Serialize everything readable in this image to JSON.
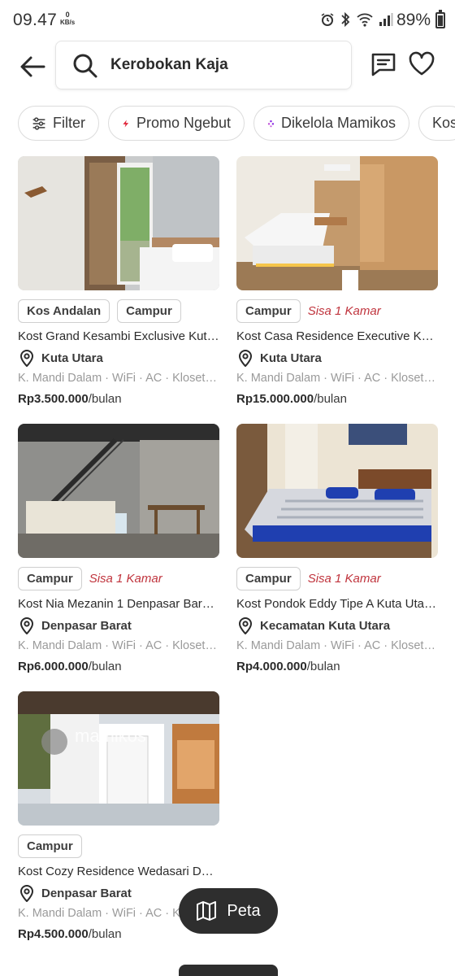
{
  "status_bar": {
    "time": "09.47",
    "net_speed": "0",
    "net_unit": "KB/s",
    "battery": "89%"
  },
  "header": {
    "search_value": "Kerobokan Kaja"
  },
  "chips": [
    {
      "label": "Filter",
      "icon": "sliders-icon"
    },
    {
      "label": "Promo Ngebut",
      "icon": "lightning-icon"
    },
    {
      "label": "Dikelola Mamikos",
      "icon": "mamikos-icon"
    },
    {
      "label": "Kos"
    }
  ],
  "listings": [
    {
      "tags": [
        "Kos Andalan",
        "Campur"
      ],
      "room_note": "",
      "title": "Kost Grand Kesambi Exclusive Kuta U...",
      "location": "Kuta Utara",
      "facilities": "K. Mandi Dalam · WiFi · AC · Kloset D...",
      "price": "Rp3.500.000",
      "period": "/bulan"
    },
    {
      "tags": [
        "Campur"
      ],
      "room_note": "Sisa 1 Kamar",
      "title": "Kost Casa Residence Executive Kuta ...",
      "location": "Kuta Utara",
      "facilities": "K. Mandi Dalam · WiFi · AC · Kloset D...",
      "price": "Rp15.000.000",
      "period": "/bulan"
    },
    {
      "tags": [
        "Campur"
      ],
      "room_note": "Sisa 1 Kamar",
      "title": "Kost Nia Mezanin 1 Denpasar Barat D...",
      "location": "Denpasar Barat",
      "facilities": "K. Mandi Dalam · WiFi · AC · Kloset D...",
      "price": "Rp6.000.000",
      "period": "/bulan"
    },
    {
      "tags": [
        "Campur"
      ],
      "room_note": "Sisa 1 Kamar",
      "title": "Kost Pondok Eddy Tipe A Kuta Utara ...",
      "location": "Kecamatan Kuta Utara",
      "facilities": "K. Mandi Dalam · WiFi · AC · Kloset D...",
      "price": "Rp4.000.000",
      "period": "/bulan"
    },
    {
      "tags": [
        "Campur"
      ],
      "room_note": "",
      "title": "Kost Cozy Residence Wedasari Denp...",
      "location": "Denpasar Barat",
      "facilities": "K. Mandi Dalam · WiFi · AC · Klo",
      "price": "Rp4.500.000",
      "period": "/bulan"
    }
  ],
  "fab": {
    "label": "Peta",
    "icon": "map-icon"
  },
  "watermark": "mamikos",
  "colors": {
    "accent_red": "#c0343d",
    "promo_red": "#e0263a",
    "mamikos_purple": "#8a2be2",
    "fab_bg": "#2e2e2e"
  }
}
